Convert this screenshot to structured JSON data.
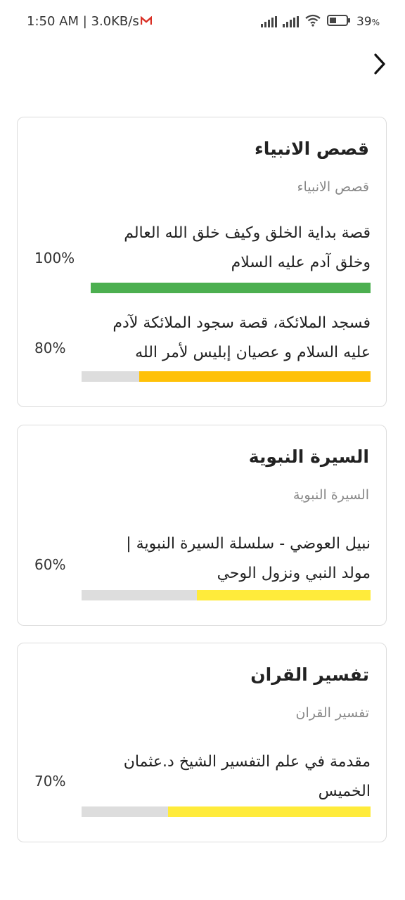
{
  "status_bar": {
    "time_speed": "1:50 AM | 3.0KB/s",
    "battery": "39",
    "battery_unit": "%"
  },
  "colors": {
    "green": "#4caf50",
    "amber": "#ffc107",
    "yellow": "#ffeb3b",
    "track": "#dddddd"
  },
  "cards": [
    {
      "title": "قصص الانبياء",
      "subtitle": "قصص الانبياء",
      "lessons": [
        {
          "line1": "قصة بداية الخلق وكيف خلق الله العالم",
          "line2": "وخلق آدم عليه السلام",
          "percent_label": "100%",
          "progress": 1.0,
          "color": "#4caf50"
        },
        {
          "line1": "فسجد الملائكة، قصة سجود الملائكة لآدم",
          "line2": "عليه السلام و عصيان إبليس لأمر الله",
          "percent_label": "80%",
          "progress": 0.8,
          "color": "#ffc107"
        }
      ]
    },
    {
      "title": "السيرة النبوية",
      "subtitle": "السيرة النبوية",
      "lessons": [
        {
          "line1": "نبيل العوضي - سلسلة السيرة النبوية |",
          "line2": "مولد النبي ونزول الوحي",
          "percent_label": "60%",
          "progress": 0.6,
          "color": "#ffeb3b"
        }
      ]
    },
    {
      "title": "تفسير القران",
      "subtitle": "تفسير القران",
      "lessons": [
        {
          "line1": "مقدمة في علم التفسير الشيخ د.عثمان",
          "line2": "الخميس",
          "percent_label": "70%",
          "progress": 0.7,
          "color": "#ffeb3b"
        }
      ]
    }
  ]
}
